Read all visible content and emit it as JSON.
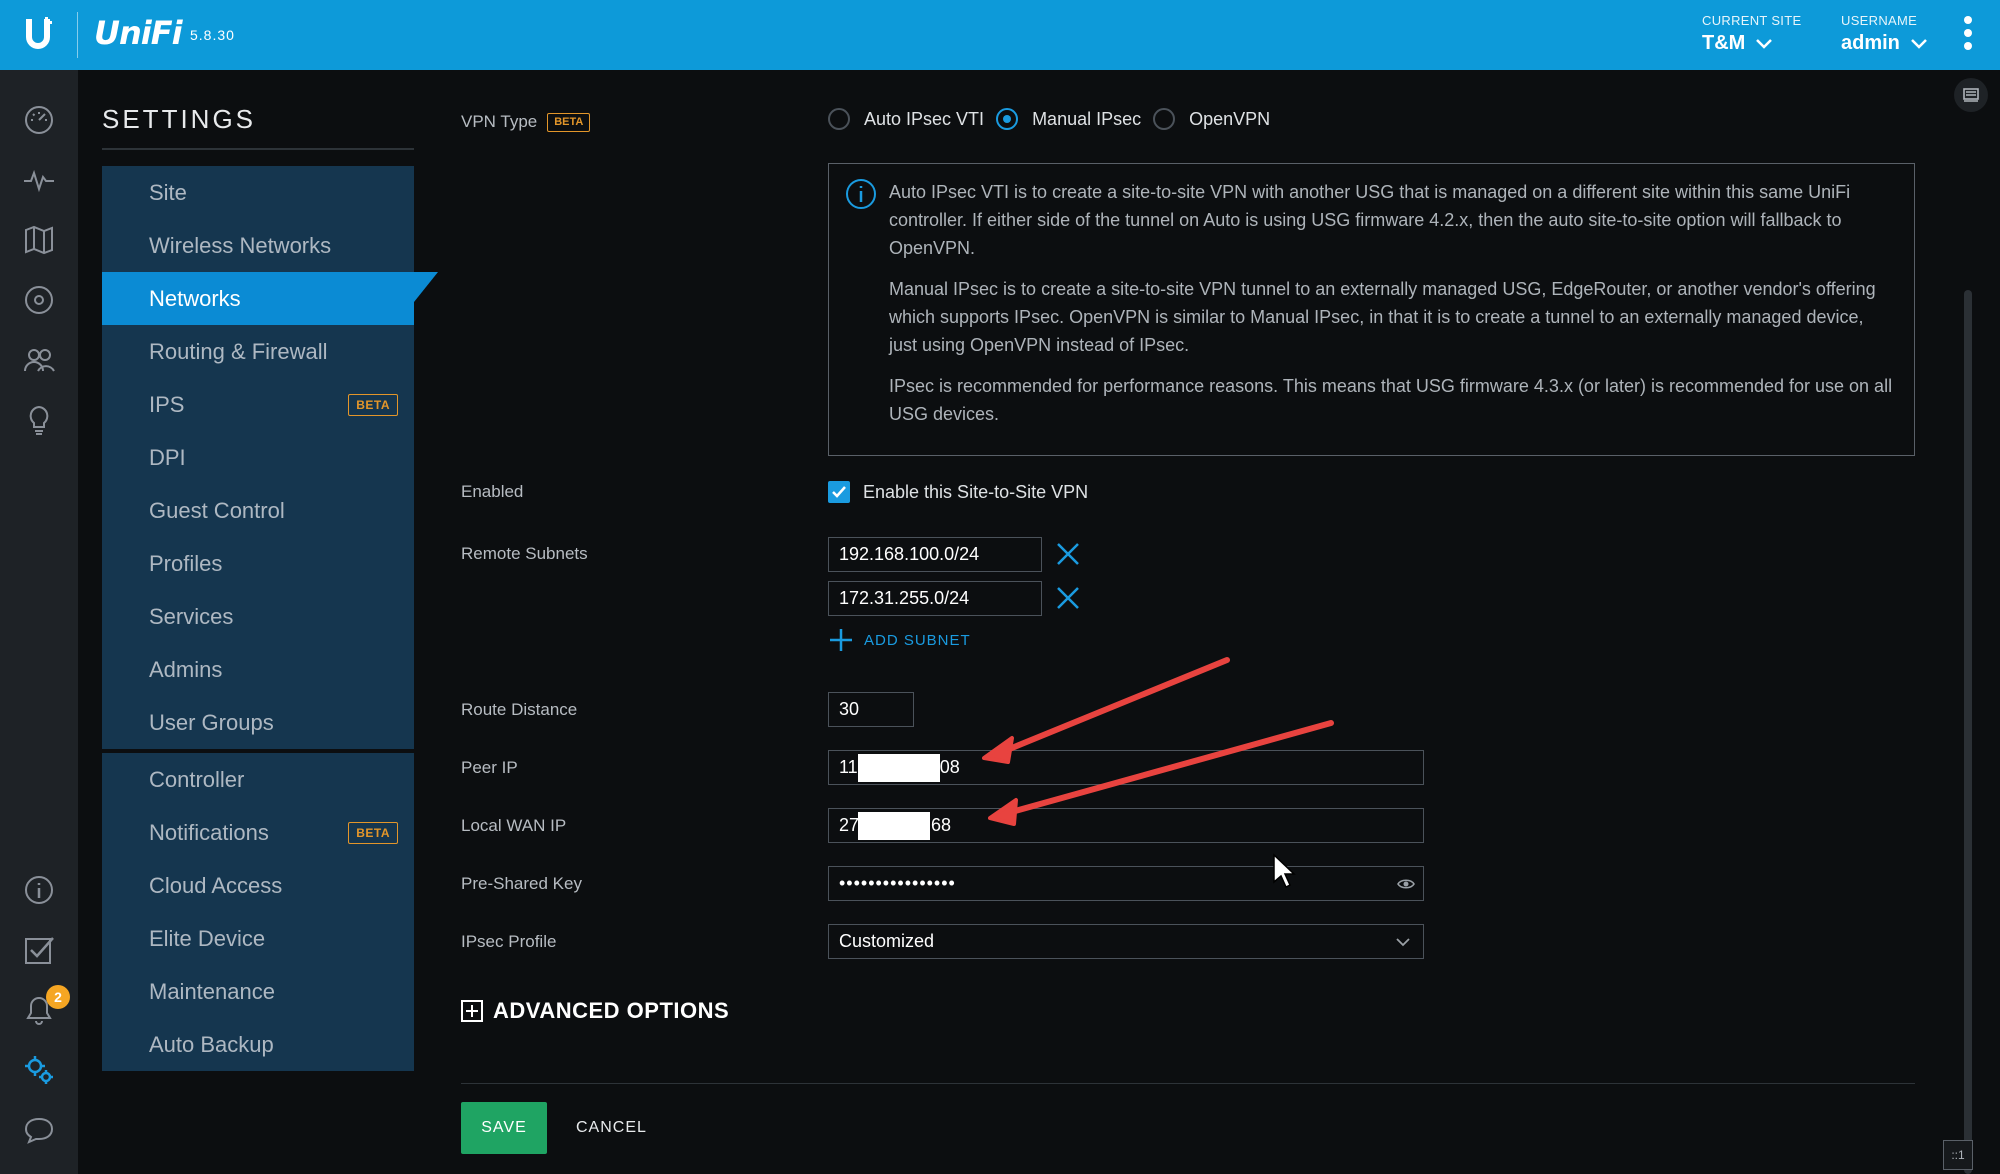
{
  "header": {
    "brand": "UniFi",
    "version": "5.8.30",
    "current_site_caption": "CURRENT SITE",
    "current_site": "T&M",
    "username_caption": "USERNAME",
    "username": "admin"
  },
  "left_nav": {
    "icons": [
      "dashboard-icon",
      "statistics-icon",
      "map-icon",
      "devices-icon",
      "clients-icon",
      "insights-icon",
      "info-icon",
      "tasks-icon",
      "alerts-icon",
      "settings-icon",
      "chat-icon"
    ],
    "alerts_count": "2"
  },
  "settings": {
    "title": "SETTINGS",
    "menu_group1": [
      {
        "label": "Site"
      },
      {
        "label": "Wireless Networks"
      },
      {
        "label": "Networks",
        "active": true
      },
      {
        "label": "Routing & Firewall"
      },
      {
        "label": "IPS",
        "badge": "BETA"
      },
      {
        "label": "DPI"
      },
      {
        "label": "Guest Control"
      },
      {
        "label": "Profiles"
      },
      {
        "label": "Services"
      },
      {
        "label": "Admins"
      },
      {
        "label": "User Groups"
      }
    ],
    "menu_group2": [
      {
        "label": "Controller"
      },
      {
        "label": "Notifications",
        "badge": "BETA"
      },
      {
        "label": "Cloud Access"
      },
      {
        "label": "Elite Device"
      },
      {
        "label": "Maintenance"
      },
      {
        "label": "Auto Backup"
      }
    ]
  },
  "form": {
    "vpn_type_label": "VPN Type",
    "vpn_type_beta": "BETA",
    "vpn_options": [
      {
        "label": "Auto IPsec VTI",
        "selected": false
      },
      {
        "label": "Manual IPsec",
        "selected": true
      },
      {
        "label": "OpenVPN",
        "selected": false
      }
    ],
    "info_paragraphs": [
      "Auto IPsec VTI is to create a site-to-site VPN with another USG that is managed on a different site within this same UniFi controller. If either side of the tunnel on Auto is using USG firmware 4.2.x, then the auto site-to-site option will fallback to OpenVPN.",
      "Manual IPsec is to create a site-to-site VPN tunnel to an externally managed USG, EdgeRouter, or another vendor's offering which supports IPsec. OpenVPN is similar to Manual IPsec, in that it is to create a tunnel to an externally managed device, just using OpenVPN instead of IPsec.",
      "IPsec is recommended for performance reasons. This means that USG firmware 4.3.x (or later) is recommended for use on all USG devices."
    ],
    "enabled_label": "Enabled",
    "enabled_checkbox_label": "Enable this Site-to-Site VPN",
    "enabled": true,
    "remote_subnets_label": "Remote Subnets",
    "remote_subnets": [
      "192.168.100.0/24",
      "172.31.255.0/24"
    ],
    "add_subnet_label": "ADD SUBNET",
    "route_distance_label": "Route Distance",
    "route_distance": "30",
    "peer_ip_label": "Peer IP",
    "peer_ip_prefix": "11",
    "peer_ip_suffix": "08",
    "local_wan_ip_label": "Local WAN IP",
    "local_wan_ip_prefix": "27",
    "local_wan_ip_suffix": "68",
    "psk_label": "Pre-Shared Key",
    "psk_value": "••••••••••••••••",
    "ipsec_profile_label": "IPsec Profile",
    "ipsec_profile": "Customized",
    "advanced_options": "ADVANCED OPTIONS",
    "save": "SAVE",
    "cancel": "CANCEL"
  },
  "corner_tag": "::1",
  "colors": {
    "topbar": "#0d9ad9",
    "accent": "#1a9be0",
    "menu_bg": "#15364f",
    "menu_active": "#0b8bd4",
    "save_green": "#1fa463",
    "beta_orange": "#e3962a",
    "annotation_arrow": "#e8433f"
  }
}
